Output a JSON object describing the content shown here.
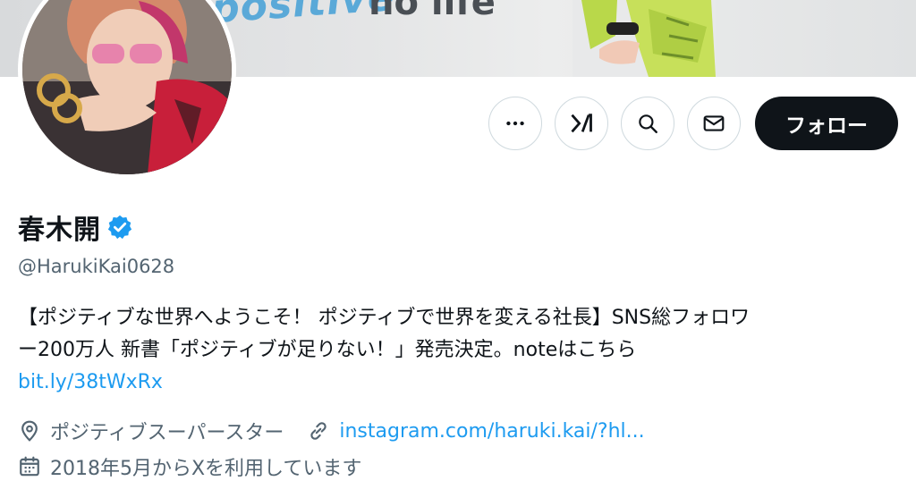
{
  "banner": {
    "text_left": "positive",
    "text_right": "no life"
  },
  "actions": {
    "more_icon": "more-icon",
    "grok_icon": "grok-icon",
    "search_icon": "search-icon",
    "message_icon": "mail-icon",
    "follow_label": "フォロー"
  },
  "profile": {
    "name": "春木開",
    "handle": "@HarukiKai0628",
    "bio_line1": "【ポジティブな世界へようこそ！ ポジティブで世界を変える社長】SNS総フォロワ",
    "bio_line2": "ー200万人 新書「ポジティブが足りない！」発売決定。noteはこちら",
    "bio_link": "bit.ly/38tWxRx",
    "location": "ポジティブスーパースター",
    "website": "instagram.com/haruki.kai/?hl...",
    "joined": "2018年5月からXを利用しています"
  },
  "colors": {
    "accent": "#1d9bf0",
    "follow_bg": "#0f1419",
    "secondary_text": "#536471",
    "border": "#cfd9de"
  }
}
